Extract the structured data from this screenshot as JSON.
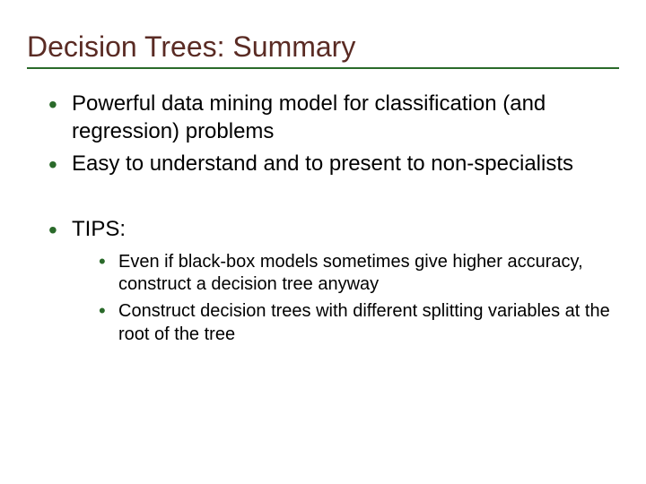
{
  "slide": {
    "title": "Decision Trees: Summary",
    "bullets": [
      "Powerful data mining model for classification (and regression) problems",
      "Easy to understand and to present to non-specialists"
    ],
    "tips_label": "TIPS:",
    "tips": [
      "Even if black-box models sometimes give higher accuracy, construct a decision tree anyway",
      "Construct decision trees with different splitting variables at the root of the tree"
    ]
  }
}
